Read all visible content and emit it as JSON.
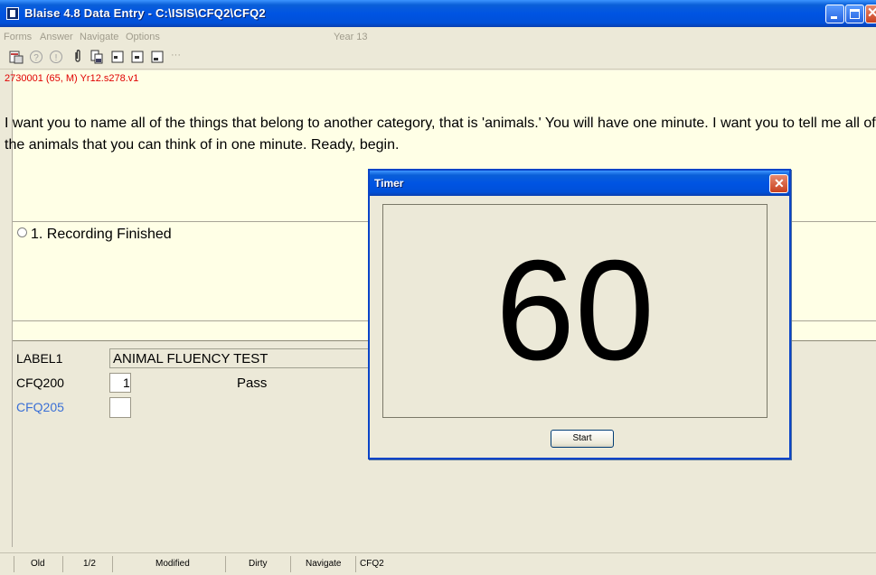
{
  "window": {
    "title": "Blaise 4.8 Data Entry - C:\\ISIS\\CFQ2\\CFQ2",
    "colors": {
      "titlebar": "#0054e3",
      "content_bg": "#ffffe6",
      "id_text": "#e00000",
      "field_link": "#3a6fd6"
    }
  },
  "menu": {
    "items": [
      "Forms",
      "Answer",
      "Navigate",
      "Options"
    ],
    "center_label": "Year 13"
  },
  "toolbar": {
    "icons": [
      "save-form-icon",
      "help-icon",
      "remark-icon",
      "attach-icon",
      "copy-form-icon",
      "first-page-icon",
      "prev-page-icon",
      "next-page-icon"
    ],
    "overflow": "···"
  },
  "question": {
    "id_line": "2730001 (65, M)  Yr12.s278.v1",
    "text": "I want you to name all of the things that belong to another category, that is 'animals.'  You will have one minute.  I want you to tell me all of the animals that you can think of in one minute.  Ready, begin.",
    "answer_option": "1. Recording Finished"
  },
  "fields": [
    {
      "name": "LABEL1",
      "value": "ANIMAL FLUENCY TEST",
      "extra": ""
    },
    {
      "name": "CFQ200",
      "value": "1",
      "extra": "Pass"
    },
    {
      "name": "CFQ205",
      "value": "",
      "extra": ""
    }
  ],
  "status": {
    "cells": [
      "Old",
      "1/2",
      "Modified",
      "Dirty",
      "Navigate",
      "CFQ2"
    ]
  },
  "timer_dialog": {
    "title": "Timer",
    "value": "60",
    "start_label": "Start"
  }
}
